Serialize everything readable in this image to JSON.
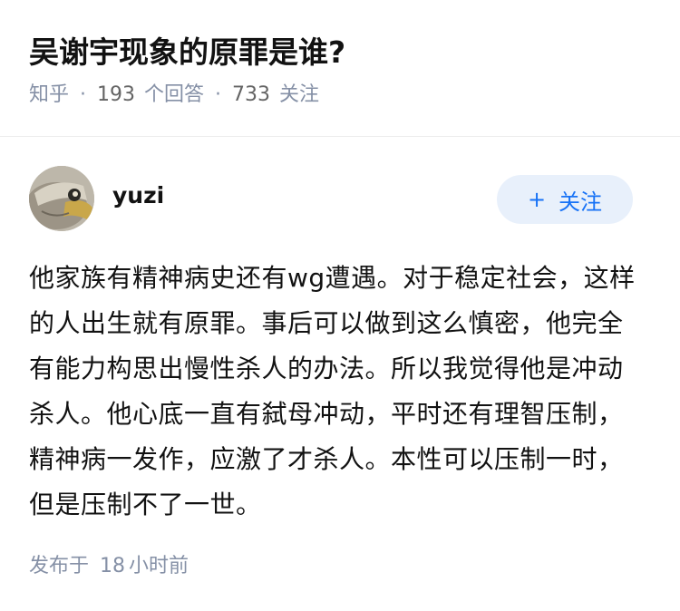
{
  "question": {
    "title": "吴谢宇现象的原罪是谁?",
    "source": "知乎",
    "answers_count": "193",
    "answers_label": "个回答",
    "followers_count": "733",
    "followers_label": "关注"
  },
  "author": {
    "name": "yuzi",
    "avatar_icon": "fish-avatar-icon",
    "follow_label": "关注",
    "follow_icon": "plus-icon"
  },
  "answer": {
    "content": "他家族有精神病史还有wg遭遇。对于稳定社会，这样的人出生就有原罪。事后可以做到这么慎密，他完全有能力构思出慢性杀人的办法。所以我觉得他是冲动杀人。他心底一直有弑母冲动，平时还有理智压制，精神病一发作，应激了才杀人。本性可以压制一时，但是压制不了一世。",
    "time_prefix": "发布于",
    "time_value": "18",
    "time_unit": "小时前"
  },
  "colors": {
    "accent": "#1772f6",
    "follow_bg": "#e8f0fb",
    "meta_gray": "#8590a6"
  }
}
